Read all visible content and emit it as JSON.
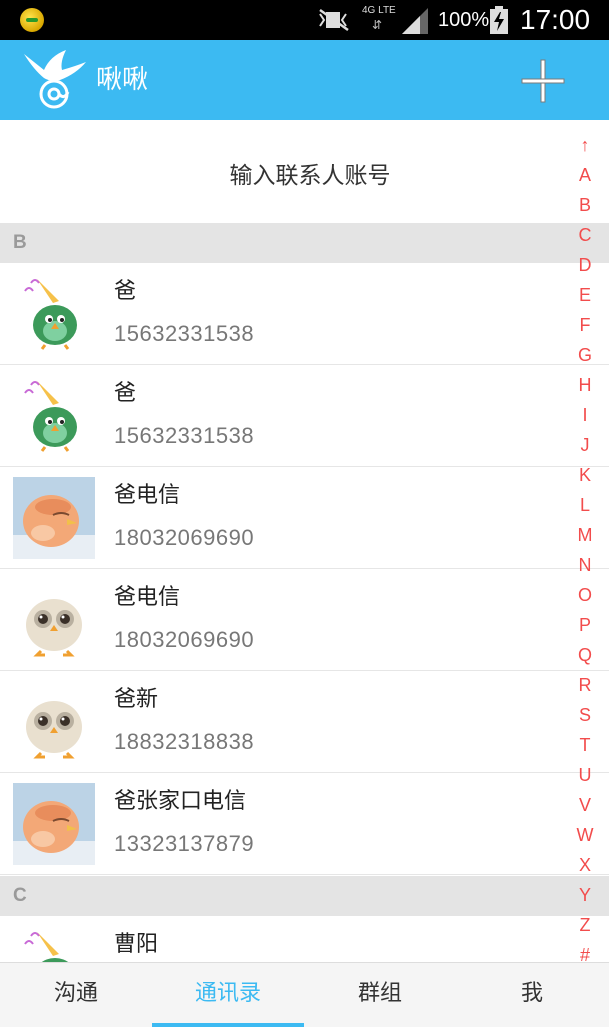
{
  "status_bar": {
    "network": "4G LTE",
    "battery": "100%",
    "time": "17:00"
  },
  "app_bar": {
    "title": "啾啾"
  },
  "search": {
    "placeholder": "输入联系人账号"
  },
  "sections": [
    {
      "letter": "B",
      "contacts": [
        {
          "name": "爸",
          "phone": "15632331538",
          "avatar": "green-bird"
        },
        {
          "name": "爸",
          "phone": "15632331538",
          "avatar": "green-bird"
        },
        {
          "name": "爸电信",
          "phone": "18032069690",
          "avatar": "orange-bird"
        },
        {
          "name": "爸电信",
          "phone": "18032069690",
          "avatar": "white-bird"
        },
        {
          "name": "爸新",
          "phone": "18832318838",
          "avatar": "white-bird"
        },
        {
          "name": "爸张家口电信",
          "phone": "13323137879",
          "avatar": "orange-bird"
        }
      ]
    },
    {
      "letter": "C",
      "contacts": [
        {
          "name": "曹阳",
          "phone": "",
          "avatar": "green-bird"
        }
      ]
    }
  ],
  "alpha_index": [
    "↑",
    "A",
    "B",
    "C",
    "D",
    "E",
    "F",
    "G",
    "H",
    "I",
    "J",
    "K",
    "L",
    "M",
    "N",
    "O",
    "P",
    "Q",
    "R",
    "S",
    "T",
    "U",
    "V",
    "W",
    "X",
    "Y",
    "Z",
    "#"
  ],
  "tabs": [
    {
      "label": "沟通",
      "active": false
    },
    {
      "label": "通讯录",
      "active": true
    },
    {
      "label": "群组",
      "active": false
    },
    {
      "label": "我",
      "active": false
    }
  ],
  "colors": {
    "accent": "#3cbaf2",
    "index_letters": "#f24c4c"
  }
}
